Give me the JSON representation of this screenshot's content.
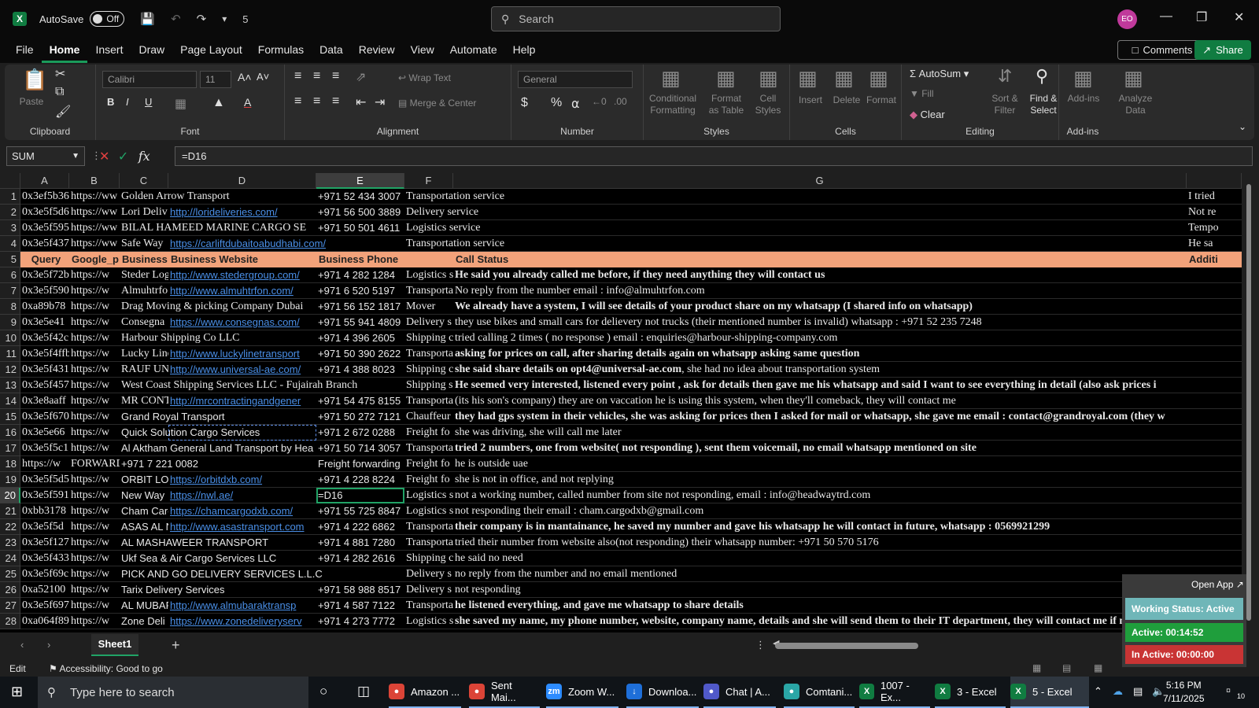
{
  "titlebar": {
    "autosave_label": "AutoSave",
    "autosave_state": "Off",
    "qat_extra": "5",
    "search_placeholder": "Search",
    "avatar_initials": "EO"
  },
  "menu": [
    "File",
    "Home",
    "Insert",
    "Draw",
    "Page Layout",
    "Formulas",
    "Data",
    "Review",
    "View",
    "Automate",
    "Help"
  ],
  "menu_active": "Home",
  "comments_label": "Comments",
  "share_label": "Share",
  "ribbon": {
    "clipboard": {
      "label": "Clipboard",
      "paste": "Paste"
    },
    "font": {
      "label": "Font",
      "name": "Calibri",
      "size": "11"
    },
    "alignment": {
      "label": "Alignment",
      "wrap": "Wrap Text",
      "merge": "Merge & Center"
    },
    "number": {
      "label": "Number",
      "format": "General"
    },
    "styles": {
      "label": "Styles",
      "cond": "Conditional Formatting",
      "table": "Format as Table",
      "cell": "Cell Styles"
    },
    "cells": {
      "label": "Cells",
      "insert": "Insert",
      "delete": "Delete",
      "format": "Format"
    },
    "editing": {
      "label": "Editing",
      "autosum": "AutoSum",
      "fill": "Fill",
      "clear": "Clear",
      "sort": "Sort & Filter",
      "find": "Find & Select"
    },
    "addins": {
      "label": "Add-ins",
      "addins": "Add-ins",
      "analyze": "Analyze Data"
    }
  },
  "formula_bar": {
    "name_box": "SUM",
    "formula": "=D16"
  },
  "columns": [
    "A",
    "B",
    "C",
    "D",
    "E",
    "F",
    "G"
  ],
  "selected_column": "E",
  "selected_row": "20",
  "rows": [
    {
      "n": "1",
      "a": "0x3ef5b36",
      "b": "https://ww",
      "c": "Golden Arrow Transport",
      "d": "",
      "e": "+971 52 434 3007",
      "f": "Transportation service",
      "g": "",
      "h": "I tried"
    },
    {
      "n": "2",
      "a": "0x3e5f5d6",
      "b": "https://ww",
      "c": "Lori Deliv",
      "d": "http://lorideliveries.com/",
      "e": "+971 56 500 3889",
      "f": "Delivery service",
      "g": "",
      "h": "Not re"
    },
    {
      "n": "3",
      "a": "0x3e5f595",
      "b": "https://ww",
      "c": "BILAL HAMEED MARINE CARGO SE",
      "d": "",
      "e": "+971 50 501 4611",
      "f": "Logistics service",
      "g": "",
      "h": "Tempo"
    },
    {
      "n": "4",
      "a": "0x3e5f437",
      "b": "https://ww",
      "c": "Safe Way",
      "d": "https://carliftdubaitoabudhabi.com/",
      "e": "",
      "f": "Transportation service",
      "g": "",
      "h": "He sa"
    },
    {
      "n": "5",
      "header": true,
      "a": "Query",
      "b": "Google_p",
      "c": "Business N",
      "d": "Business Website",
      "e": "Business Phone",
      "f": "",
      "g": "Call Status",
      "h": "Additi"
    },
    {
      "n": "6",
      "a": "0x3e5f72b",
      "b": "https://w",
      "c": "Steder Log",
      "d": "http://www.stedergroup.com/",
      "e": "+971 4 282 1284",
      "f": "Logistics s",
      "g": "He said you already called me before, if they need anything they will contact us",
      "gb": true
    },
    {
      "n": "7",
      "a": "0x3e5f590",
      "b": "https://w",
      "c": "Almuhtrfo",
      "d": "http://www.almuhtrfon.com/",
      "e": "+971 6 520 5197",
      "f": "Transporta",
      "g": "No reply from the number  email : info@almuhtrfon.com"
    },
    {
      "n": "8",
      "a": "0xa89b78",
      "b": "https://w",
      "c": "Drag Moving & picking Company Dubai",
      "d": "",
      "e": "+971 56 152 1817",
      "f": "Mover",
      "g": "We already have a system, I will see details of your product share on my whatsapp (I shared info on whatsapp)",
      "gb": true
    },
    {
      "n": "9",
      "a": "0x3e5e41",
      "b": "https://w",
      "c": "Consegna",
      "d": "https://www.consegnas.com/",
      "e": "+971 55 941 4809",
      "f": "Delivery s",
      "g": "they use bikes and small cars for delievery not trucks (their mentioned number is invalid) whatsapp : +971 52 235 7248"
    },
    {
      "n": "10",
      "a": "0x3e5f42c",
      "b": "https://w",
      "c": "Harbour Shipping Co LLC",
      "d": "",
      "e": "+971 4 396 2605",
      "f": "Shipping c",
      "g": "tried calling 2 times ( no response ) email : enquiries@harbour-shipping-company.com"
    },
    {
      "n": "11",
      "a": "0x3e5f4ffb",
      "b": "https://w",
      "c": "Lucky Line",
      "d": "http://www.luckylinetransport",
      "e": "+971 50 390 2622",
      "f": "Transporta",
      "g": "asking for prices on call, after sharing details again on whatsapp asking same question",
      "gb": true
    },
    {
      "n": "12",
      "a": "0x3e5f431",
      "b": "https://w",
      "c": "RAUF UNI",
      "d": "http://www.universal-ae.com/",
      "e": "+971 4 388 8023",
      "f": "Shipping c",
      "g": "she said share details on opt4@universal-ae.com, she had no idea about transportation system",
      "gbp": "she said share details on opt4@universal-ae.com"
    },
    {
      "n": "13",
      "a": "0x3e5f4570",
      "b": "https://w",
      "c": "West Coast Shipping Services LLC - Fujairah Branch",
      "d": "",
      "e": "",
      "f": "Shipping s",
      "g": "He seemed very interested, listened every point , ask for details then gave me his whatsapp and said I want to see everything in detail (also ask prices i",
      "gb": true
    },
    {
      "n": "14",
      "a": "0x3e8aaff",
      "b": "https://w",
      "c": "MR CONTI",
      "d": "http://mrcontractingandgener",
      "e": "+971 54 475 8155",
      "f": "Transporta",
      "g": "(its his son's company) they are on vaccation he is using this system, when they'll comeback, they will contact me"
    },
    {
      "n": "15",
      "a": "0x3e5f670",
      "b": "https://w",
      "c": "Grand Royal Transport",
      "d": "",
      "e": "+971 50 272 7121",
      "f": "Chauffeur",
      "g": "they had gps system in their vehicles, she was asking for prices then I asked for mail or whatsapp, she gave me email : contact@grandroyal.com (they w",
      "gb": true
    },
    {
      "n": "16",
      "a": "0x3e5e66",
      "b": "https://w",
      "c": "Quick Solution Cargo Services",
      "d": "",
      "e": "+971 2 672 0288",
      "f": "Freight fo",
      "g": "she was driving, she will call me later"
    },
    {
      "n": "17",
      "a": "0x3e5f5c1",
      "b": "https://w",
      "c": "Al Aktham General Land Transport by Hea",
      "d": "",
      "e": "+971 50 714 3057",
      "f": "Transporta",
      "g": "tried 2 numbers, one from website( not responding ), sent them voicemail, no email whatsapp mentioned on site",
      "gb": true
    },
    {
      "n": "18",
      "a": "https://w",
      "b": "FORWARD FREIGHT L",
      "c": "+971 7 221 0082",
      "d": "",
      "e": "Freight forwarding",
      "f": "Freight fo",
      "g": "he is outside uae"
    },
    {
      "n": "19",
      "a": "0x3e5f5d5",
      "b": "https://w",
      "c": "ORBIT LOG",
      "d": "https://orbitdxb.com/",
      "e": "+971 4 228 8224",
      "f": "Freight fo",
      "g": "she is not in office, and not replying"
    },
    {
      "n": "20",
      "a": "0x3e5f591",
      "b": "https://w",
      "c": "New Way",
      "d": "https://nwl.ae/",
      "e": "=D16",
      "f": "Logistics s",
      "g": "not a working number, called number from site not responding, email : info@headwaytrd.com"
    },
    {
      "n": "21",
      "a": "0xbb3178",
      "b": "https://w",
      "c": "Cham Carg",
      "d": "https://chamcargodxb.com/",
      "e": "+971 55 725 8847",
      "f": "Logistics s",
      "g": "not responding their email : cham.cargodxb@gmail.com"
    },
    {
      "n": "22",
      "a": "0x3e5f5d",
      "b": "https://w",
      "c": "ASAS AL N",
      "d": "http://www.asastransport.com",
      "e": "+971 4 222 6862",
      "f": "Transporta",
      "g": "their company is in mantainance, he saved my number and gave his whatsapp he will contact in future, whatsapp : 0569921299",
      "gb": true
    },
    {
      "n": "23",
      "a": "0x3e5f127",
      "b": "https://w",
      "c": "AL MASHAWEER TRANSPORT",
      "d": "",
      "e": "+971 4 881 7280",
      "f": "Transporta",
      "g": "tried their number from website also(not responding) their whatsapp number: +971 50 570 5176"
    },
    {
      "n": "24",
      "a": "0x3e5f433",
      "b": "https://w",
      "c": "Ukf Sea & Air Cargo Services LLC",
      "d": "",
      "e": "+971 4 282 2616",
      "f": "Shipping c",
      "g": "he said no need"
    },
    {
      "n": "25",
      "a": "0x3e5f69c",
      "b": "https://w",
      "c": "PICK AND GO DELIVERY SERVICES L.L.C",
      "d": "",
      "e": "",
      "f": "Delivery s",
      "g": "no reply from the number and no email mentioned"
    },
    {
      "n": "26",
      "a": "0xa52100",
      "b": "https://w",
      "c": "Tarix Delivery Services",
      "d": "",
      "e": "+971 58 988 8517",
      "f": "Delivery s",
      "g": "not responding"
    },
    {
      "n": "27",
      "a": "0x3e5f697",
      "b": "https://w",
      "c": "AL MUBAF",
      "d": "http://www.almubaraktransp",
      "e": "+971 4 587 7122",
      "f": "Transporta",
      "g": "he listened everything, and gave me whatsapp to share details",
      "gb": true
    },
    {
      "n": "28",
      "a": "0xa064f89",
      "b": "https://w",
      "c": "Zone Deli",
      "d": "https://www.zonedeliveryserv",
      "e": "+971 4 273 7772",
      "f": "Logistics s",
      "g": "she saved my name, my phone number, website, company name, details and she will send them to their IT department, they will contact me if needed",
      "gb": true
    }
  ],
  "sheet_tab": "Sheet1",
  "status": {
    "mode": "Edit",
    "accessibility": "Accessibility: Good to go"
  },
  "tracker": {
    "open_app": "Open App ↗",
    "working": "Working Status: Active",
    "active": "Active: 00:14:52",
    "inactive": "In Active: 00:00:00"
  },
  "taskbar": {
    "search_placeholder": "Type here to search",
    "apps": [
      {
        "label": "Amazon ...",
        "icon": "chrome-icon",
        "color": "#db4437"
      },
      {
        "label": "Sent Mai...",
        "icon": "chrome-icon",
        "color": "#db4437"
      },
      {
        "label": "Zoom W...",
        "icon": "zoom-icon",
        "color": "#2d8cff"
      },
      {
        "label": "Downloa...",
        "icon": "download-icon",
        "color": "#1e6fd9"
      },
      {
        "label": "Chat | A...",
        "icon": "teams-icon",
        "color": "#5059c9"
      },
      {
        "label": "Comtani...",
        "icon": "app-icon",
        "color": "#2aa6a6"
      },
      {
        "label": "1007 - Ex...",
        "icon": "excel-icon",
        "color": "#107c41"
      },
      {
        "label": "3 - Excel",
        "icon": "excel-icon",
        "color": "#107c41"
      },
      {
        "label": "5 - Excel",
        "icon": "excel-icon",
        "color": "#107c41"
      }
    ],
    "time": "5:16 PM",
    "date": "7/11/2025",
    "notifications": "10"
  }
}
